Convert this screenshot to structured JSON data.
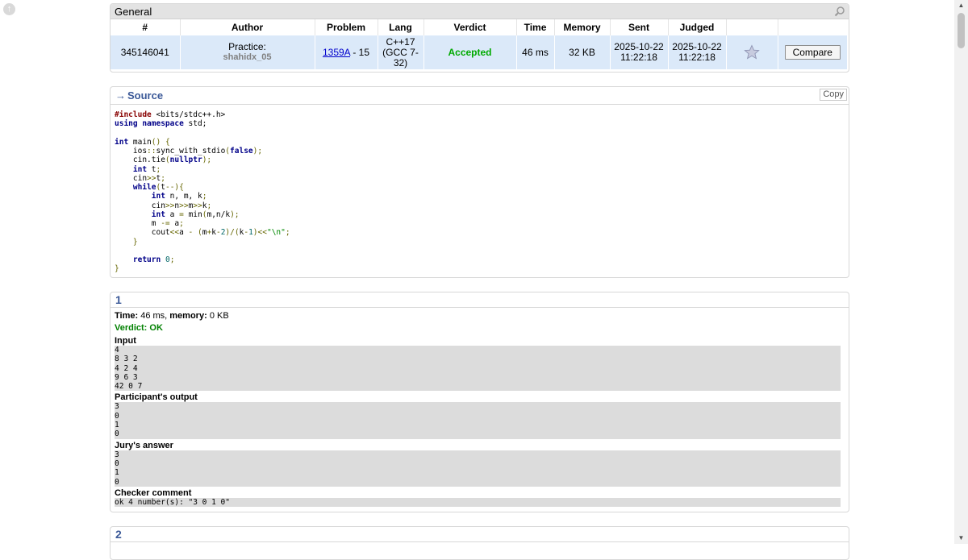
{
  "general": {
    "title": "General",
    "columns": [
      "#",
      "Author",
      "Problem",
      "Lang",
      "Verdict",
      "Time",
      "Memory",
      "Sent",
      "Judged",
      "",
      ""
    ],
    "submission": {
      "id": "345146041",
      "author_prefix": "Practice:",
      "author_handle": "shahidx_05",
      "problem_code": "1359A",
      "problem_suffix": " - 15",
      "lang": "C++17 (GCC 7-32)",
      "verdict": "Accepted",
      "time": "46 ms",
      "memory": "32 KB",
      "sent": "2025-10-22 11:22:18",
      "judged": "2025-10-22 11:22:18",
      "compare_label": "Compare"
    }
  },
  "source": {
    "arrow": "→",
    "title": "Source",
    "copy_label": "Copy"
  },
  "tests": [
    {
      "number": "1",
      "time_label": "Time:",
      "time_value": "46 ms,",
      "memory_label": "memory:",
      "memory_value": "0 KB",
      "verdict_label": "Verdict:",
      "verdict_value": "OK",
      "input_label": "Input",
      "input": "4\n8 3 2\n4 2 4\n9 6 3\n42 0 7",
      "output_label": "Participant's output",
      "output": "3\n0\n1\n0",
      "answer_label": "Jury's answer",
      "answer": "3\n0\n1\n0",
      "checker_label": "Checker comment",
      "checker": "ok 4 number(s): \"3 0 1 0\""
    },
    {
      "number": "2"
    }
  ]
}
